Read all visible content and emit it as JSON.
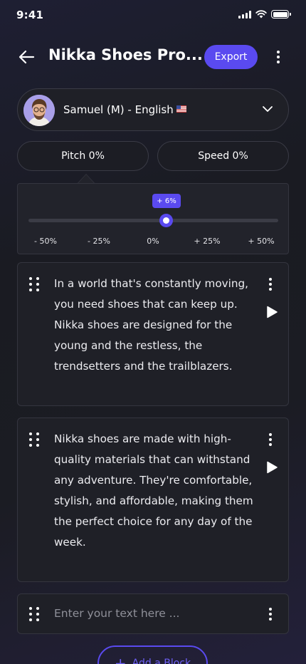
{
  "status_bar": {
    "time": "9:41"
  },
  "header": {
    "title": "Nikka Shoes Pro...",
    "export_label": "Export"
  },
  "voice": {
    "label": "Samuel (M) - English",
    "flag_icon": "us-flag-icon"
  },
  "controls": {
    "pitch_label": "Pitch 0%",
    "speed_label": "Speed 0%"
  },
  "pitch_slider": {
    "tooltip": "+ 6%",
    "value_percent": 6,
    "min": -50,
    "max": 50,
    "ticks": [
      "- 50%",
      "- 25%",
      "0%",
      "+ 25%",
      "+ 50%"
    ]
  },
  "blocks": [
    {
      "text": "In a world that's constantly moving, you need shoes that can keep up. Nikka shoes are designed for the young and the restless, the trendsetters and the trailblazers."
    },
    {
      "text": "Nikka shoes are made with high-quality materials that can withstand any adventure. They're comfortable, stylish, and affordable, making them the perfect choice for any day of the week."
    }
  ],
  "new_block": {
    "placeholder": "Enter your text here ..."
  },
  "add_block_label": "Add a Block",
  "colors": {
    "accent": "#5a4af0",
    "background": "#1b1c23",
    "surface": "#1f2027",
    "border": "#34353f"
  }
}
